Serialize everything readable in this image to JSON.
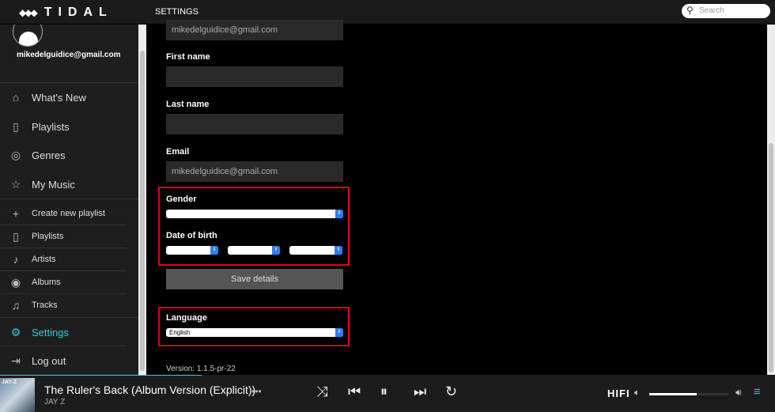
{
  "header": {
    "logo": "TIDAL",
    "page_title": "SETTINGS",
    "search_placeholder": "Search"
  },
  "sidebar": {
    "email": "mikedelguidice@gmail.com",
    "main_nav": [
      {
        "label": "What's New",
        "icon": "home-icon"
      },
      {
        "label": "Playlists",
        "icon": "playlist-icon"
      },
      {
        "label": "Genres",
        "icon": "disc-icon"
      },
      {
        "label": "My Music",
        "icon": "star-icon"
      }
    ],
    "my_music": [
      {
        "label": "Create new playlist",
        "icon": "plus-icon"
      },
      {
        "label": "Playlists",
        "icon": "playlist-icon"
      },
      {
        "label": "Artists",
        "icon": "microphone-icon"
      },
      {
        "label": "Albums",
        "icon": "album-icon"
      },
      {
        "label": "Tracks",
        "icon": "music-note-icon"
      }
    ],
    "settings": "Settings",
    "logout": "Log out",
    "active_color": "#2ad3d3"
  },
  "form": {
    "username_value": "mikedelguidice@gmail.com",
    "first_name_label": "First name",
    "first_name_value": "",
    "last_name_label": "Last name",
    "last_name_value": "",
    "email_label": "Email",
    "email_value": "mikedelguidice@gmail.com",
    "gender_label": "Gender",
    "gender_value": "",
    "dob_label": "Date of birth",
    "save_label": "Save details",
    "language_label": "Language",
    "language_value": "English",
    "version": "Version: 1.1.5-pr-22",
    "highlight_color": "#e00010"
  },
  "player": {
    "album_art_text": "JAY-Z",
    "track": "The Ruler's Back (Album Version (Explicit))",
    "artist": "JAY Z",
    "more": "•••",
    "quality": "HIFI",
    "progress_percent": 26,
    "volume_percent": 60,
    "accent": "#1ee0e0"
  }
}
